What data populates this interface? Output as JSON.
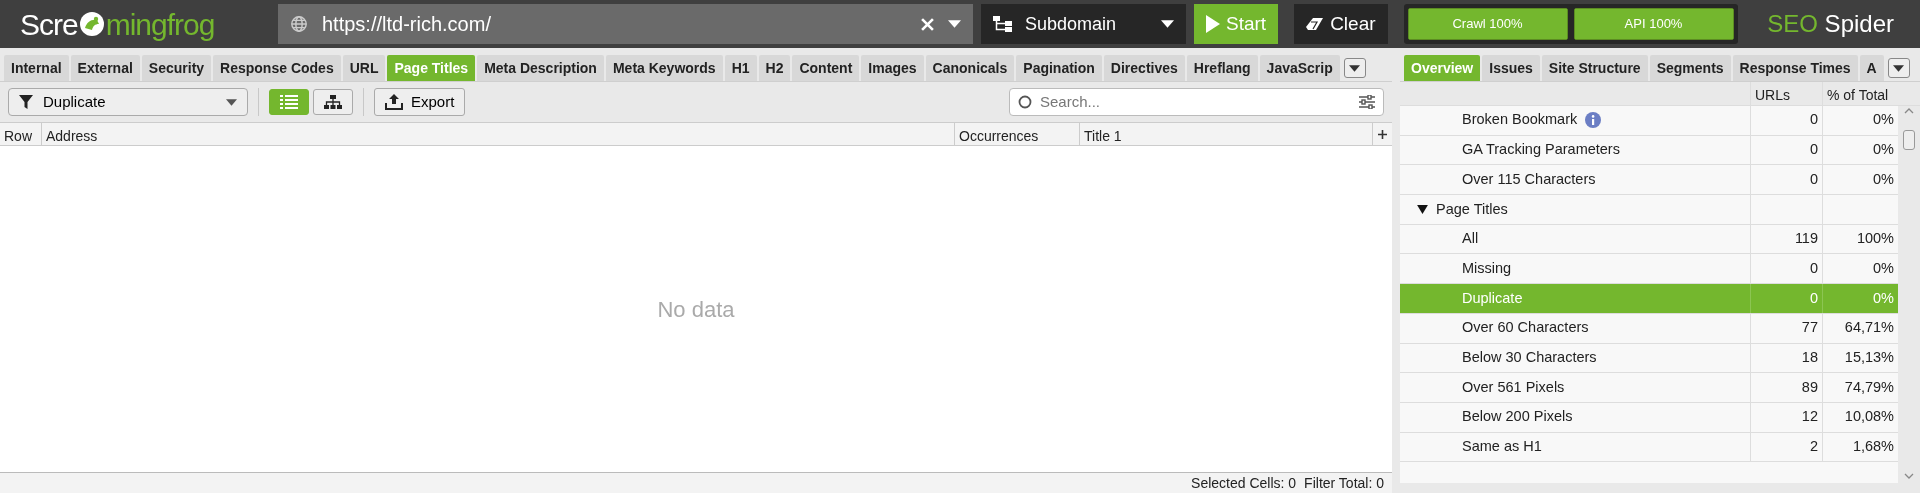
{
  "logo": {
    "parts": [
      "Scre",
      "mingfrog"
    ]
  },
  "url_field": {
    "value": "https://ltd-rich.com/"
  },
  "mode_dropdown": {
    "value": "Subdomain"
  },
  "buttons": [
    {
      "label": "Start",
      "kind": "start"
    },
    {
      "label": "Clear",
      "kind": "clear"
    }
  ],
  "progress": [
    {
      "label": "Crawl 100%",
      "level": 1
    },
    {
      "label": "API 100%",
      "level": 1
    }
  ],
  "product": {
    "parts": [
      "SEO",
      "Spider"
    ]
  },
  "left_tabs": [
    {
      "label": "Internal",
      "selected": false
    },
    {
      "label": "External",
      "selected": false
    },
    {
      "label": "Security",
      "selected": false
    },
    {
      "label": "Response Codes",
      "selected": false
    },
    {
      "label": "URL",
      "selected": false
    },
    {
      "label": "Page Titles",
      "selected": true
    },
    {
      "label": "Meta Description",
      "selected": false
    },
    {
      "label": "Meta Keywords",
      "selected": false
    },
    {
      "label": "H1",
      "selected": false
    },
    {
      "label": "H2",
      "selected": false
    },
    {
      "label": "Content",
      "selected": false
    },
    {
      "label": "Images",
      "selected": false
    },
    {
      "label": "Canonicals",
      "selected": false
    },
    {
      "label": "Pagination",
      "selected": false
    },
    {
      "label": "Directives",
      "selected": false
    },
    {
      "label": "Hreflang",
      "selected": false
    },
    {
      "label": "JavaScrip",
      "selected": false
    }
  ],
  "filter": {
    "value": "Duplicate"
  },
  "view_toggle": [
    {
      "kind": "list",
      "selected": true
    },
    {
      "kind": "tree",
      "selected": false
    }
  ],
  "export_button": {
    "label": "Export"
  },
  "search": {
    "placeholder": "Search..."
  },
  "table": {
    "columns": [
      "Row",
      "Address",
      "Occurrences",
      "Title 1"
    ],
    "empty_text": "No data"
  },
  "status_bar": [
    {
      "label": "Selected Cells:",
      "value": "0"
    },
    {
      "label": "Filter Total:",
      "value": "0"
    }
  ],
  "right_tabs": [
    {
      "label": "Overview",
      "selected": true
    },
    {
      "label": "Issues",
      "selected": false
    },
    {
      "label": "Site Structure",
      "selected": false
    },
    {
      "label": "Segments",
      "selected": false
    },
    {
      "label": "Response Times",
      "selected": false
    },
    {
      "label": "A",
      "selected": false
    }
  ],
  "overview": {
    "columns": [
      "URLs",
      "% of Total"
    ],
    "rows": [
      {
        "children": [
          {
            "label": "Broken Bookmark",
            "info": true,
            "urls": "0",
            "percent": "0%",
            "selected": false
          },
          {
            "label": "GA Tracking Parameters",
            "info": false,
            "urls": "0",
            "percent": "0%",
            "selected": false
          },
          {
            "label": "Over 115 Characters",
            "info": false,
            "urls": "0",
            "percent": "0%",
            "selected": false
          }
        ]
      },
      {
        "label": "Page Titles",
        "expanded": true,
        "children": [
          {
            "label": "All",
            "info": false,
            "urls": "119",
            "percent": "100%",
            "selected": false
          },
          {
            "label": "Missing",
            "info": false,
            "urls": "0",
            "percent": "0%",
            "selected": false
          },
          {
            "label": "Duplicate",
            "info": false,
            "urls": "0",
            "percent": "0%",
            "selected": true
          },
          {
            "label": "Over 60 Characters",
            "info": false,
            "urls": "77",
            "percent": "64,71%",
            "selected": false
          },
          {
            "label": "Below 30 Characters",
            "info": false,
            "urls": "18",
            "percent": "15,13%",
            "selected": false
          },
          {
            "label": "Over 561 Pixels",
            "info": false,
            "urls": "89",
            "percent": "74,79%",
            "selected": false
          },
          {
            "label": "Below 200 Pixels",
            "info": false,
            "urls": "12",
            "percent": "10,08%",
            "selected": false
          },
          {
            "label": "Same as H1",
            "info": false,
            "urls": "2",
            "percent": "1,68%",
            "selected": false
          }
        ]
      }
    ]
  }
}
